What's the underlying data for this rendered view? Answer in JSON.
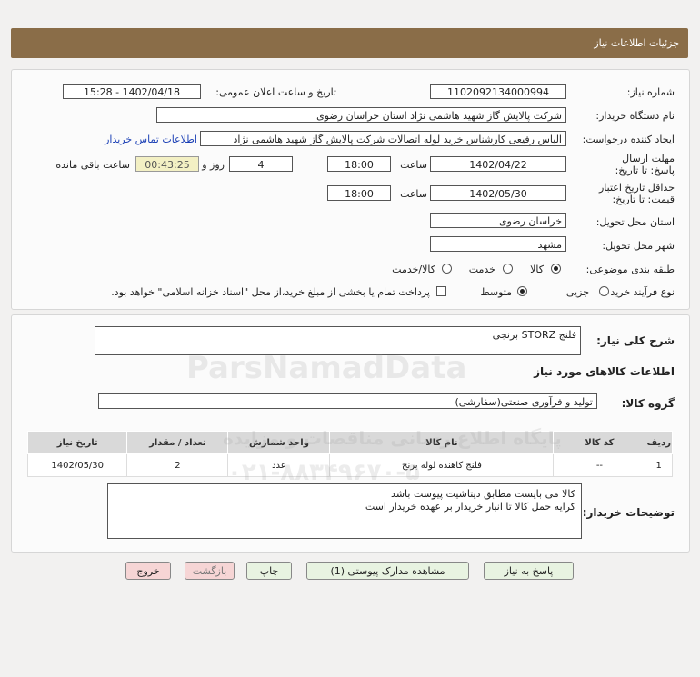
{
  "header": {
    "title": "جزئیات اطلاعات نیاز"
  },
  "form": {
    "need_number_label": "شماره نیاز:",
    "need_number": "1102092134000994",
    "announce_label": "تاریخ و ساعت اعلان عمومی:",
    "announce_value": "1402/04/18 - 15:28",
    "buyer_org_label": "نام دستگاه خریدار:",
    "buyer_org": "شرکت پالایش گاز شهید هاشمی نژاد   استان خراسان رضوی",
    "creator_label": "ایجاد کننده درخواست:",
    "creator": "الیاس رفیعی کارشناس خرید لوله اتصالات شرکت پالایش گاز شهید هاشمی نژاد",
    "contact_link": "اطلاعات تماس خریدار",
    "reply_deadline_label": "مهلت ارسال پاسخ: تا تاریخ:",
    "reply_date": "1402/04/22",
    "time_label": "ساعت",
    "reply_time": "18:00",
    "days_value": "4",
    "days_label": "روز و",
    "remaining_time": "00:43:25",
    "remaining_label": "ساعت باقی مانده",
    "validity_label": "حداقل تاریخ اعتبار قیمت: تا تاریخ:",
    "validity_date": "1402/05/30",
    "validity_time": "18:00",
    "delivery_place_label": "استان محل تحویل:",
    "delivery_place": "خراسان رضوی",
    "delivery_city_label": "شهر محل تحویل:",
    "delivery_city": "مشهد",
    "category_label": "طبقه بندی موضوعی:",
    "category_options": [
      "کالا",
      "خدمت",
      "کالا/خدمت"
    ],
    "category_selected": "کالا",
    "process_label": "نوع فرآیند خرید :",
    "process_options": [
      "جزیی",
      "متوسط"
    ],
    "process_selected": "متوسط",
    "payment_note": "پرداخت تمام یا بخشی از مبلغ خرید،از محل \"اسناد خزانه اسلامی\" خواهد بود."
  },
  "details": {
    "summary_label": "شرح کلی نیاز:",
    "summary": "فلنج STORZ برنجی",
    "goods_info_title": "اطلاعات کالاهای مورد نیاز",
    "goods_group_label": "گروه کالا:",
    "goods_group": "تولید و فرآوری صنعتی(سفارشی)",
    "table": {
      "headers": [
        "ردیف",
        "کد کالا",
        "نام کالا",
        "واحد شمارش",
        "تعداد / مقدار",
        "تاریخ نیاز"
      ],
      "rows": [
        [
          "1",
          "--",
          "فلنج کاهنده لوله برنج",
          "عدد",
          "2",
          "1402/05/30"
        ]
      ]
    },
    "buyer_notes_label": "توضیحات خریدار:",
    "buyer_notes_line1": "کالا می بایست مطابق دیتاشیت پیوست باشد",
    "buyer_notes_line2": "کرایه حمل کالا تا انبار خریدار بر عهده خریدار است"
  },
  "buttons": {
    "reply": "پاسخ به نیاز",
    "attachments": "مشاهده مدارک پیوستی (1)",
    "print": "چاپ",
    "back": "بازگشت",
    "exit": "خروج"
  },
  "watermark": {
    "brand": "ParsNamadData",
    "line1": "پایگاه اطلاع رسانی مناقصات و مزایده",
    "phone": "۰۲۱-۸۸۳۴۹۶۷۰-۵"
  }
}
